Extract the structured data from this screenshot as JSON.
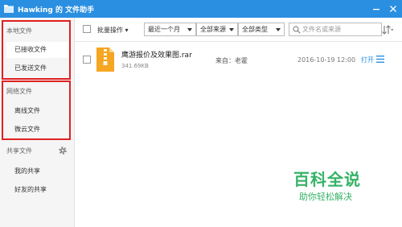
{
  "window": {
    "title": "Hawking 的 文件助手",
    "accent": "#2a8fe0",
    "app_icon": "folder-icon",
    "minimize_icon": "minimize-icon",
    "close_icon": "close-icon"
  },
  "sidebar": {
    "local": {
      "heading": "本地文件",
      "items": [
        {
          "label": "已接收文件",
          "active": true
        },
        {
          "label": "已发送文件",
          "active": false
        }
      ]
    },
    "network": {
      "heading": "网络文件",
      "items": [
        {
          "label": "离线文件"
        },
        {
          "label": "微云文件"
        }
      ]
    },
    "shared": {
      "heading": "共享文件",
      "settings_icon": "gear-icon",
      "items": [
        {
          "label": "我的共享"
        },
        {
          "label": "好友的共享"
        }
      ]
    },
    "highlight_color": "#e02020"
  },
  "toolbar": {
    "batch_label": "批量操作",
    "time_filter": "最近一个月",
    "source_filter": "全部来源",
    "type_filter": "全部类型",
    "search_placeholder": "文件名或来源",
    "search_icon": "search-icon",
    "sort_icon": "sort-icon"
  },
  "files": [
    {
      "name": "鹰游报价及效果图.rar",
      "size": "341.69KB",
      "sender": "来自：老霍",
      "date": "2016-10-19 12:00",
      "open_label": "打开",
      "icon": "archive-file-icon",
      "menu_icon": "menu-icon"
    }
  ],
  "watermark": {
    "main": "百科全说",
    "sub": "助你轻松解决",
    "color": "#35b266"
  }
}
